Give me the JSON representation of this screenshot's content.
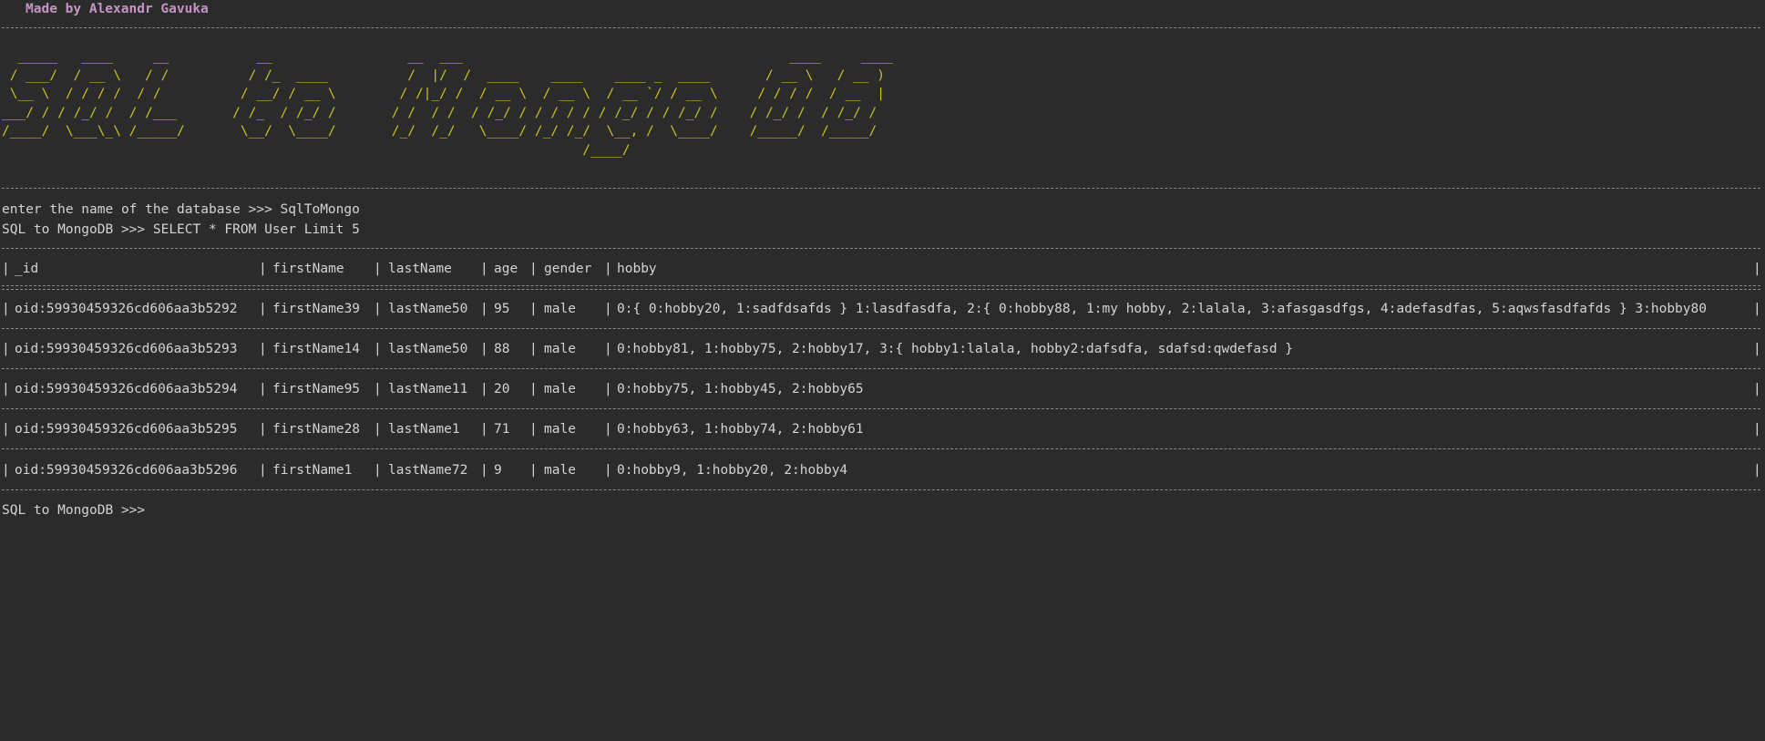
{
  "author": "Made by Alexandr Gavuka",
  "banner": [
    "  _____   ____     __           __                 __  ___                                         ____     ____",
    " / ___/  / __ \\   / /          / /_  ____          /  |/  /  ____    ____    ____ _  ____       / __ \\   / __ )",
    " \\__ \\  / / / /  / /          / __/ / __ \\        / /|_/ /  / __ \\  / __ \\  / __ `/ / __ \\     / / / /  / __  |",
    "___/ / / /_/ /  / /___       / /_  / /_/ /       / /  / /  / /_/ / / / / / / /_/ / / /_/ /    / /_/ /  / /_/ /",
    "/____/  \\___\\_\\ /_____/       \\__/  \\____/       /_/  /_/   \\____/ /_/ /_/  \\__, /  \\____/    /_____/  /_____/",
    "                                                                         /____/"
  ],
  "db_prompt": "enter the name of the database >>> SqlToMongo",
  "query_prompt": "SQL to MongoDB >>> SELECT * FROM User Limit 5",
  "table": {
    "headers": {
      "id": "_id",
      "first": "firstName",
      "last": "lastName",
      "age": "age",
      "gender": "gender",
      "hobby": "hobby"
    },
    "rows": [
      {
        "id": "oid:59930459326cd606aa3b5292",
        "first": "firstName39",
        "last": "lastName50",
        "age": "95",
        "gender": "male",
        "hobby": "0:{ 0:hobby20, 1:sadfdsafds } 1:lasdfasdfa, 2:{ 0:hobby88, 1:my hobby, 2:lalala, 3:afasgasdfgs, 4:adefasdfas, 5:aqwsfasdfafds } 3:hobby80"
      },
      {
        "id": "oid:59930459326cd606aa3b5293",
        "first": "firstName14",
        "last": "lastName50",
        "age": "88",
        "gender": "male",
        "hobby": "0:hobby81, 1:hobby75, 2:hobby17, 3:{ hobby1:lalala, hobby2:dafsdfa, sdafsd:qwdefasd }"
      },
      {
        "id": "oid:59930459326cd606aa3b5294",
        "first": "firstName95",
        "last": "lastName11",
        "age": "20",
        "gender": "male",
        "hobby": "0:hobby75, 1:hobby45, 2:hobby65"
      },
      {
        "id": "oid:59930459326cd606aa3b5295",
        "first": "firstName28",
        "last": "lastName1",
        "age": "71",
        "gender": "male",
        "hobby": "0:hobby63, 1:hobby74, 2:hobby61"
      },
      {
        "id": "oid:59930459326cd606aa3b5296",
        "first": "firstName1",
        "last": "lastName72",
        "age": "9",
        "gender": "male",
        "hobby": "0:hobby9, 1:hobby20, 2:hobby4"
      }
    ]
  },
  "final_prompt": "SQL to MongoDB >>>",
  "colors": {
    "background": "#2b2b2b",
    "text": "#d4d4d4",
    "author": "#c594c5",
    "banner": "#c9c221"
  }
}
